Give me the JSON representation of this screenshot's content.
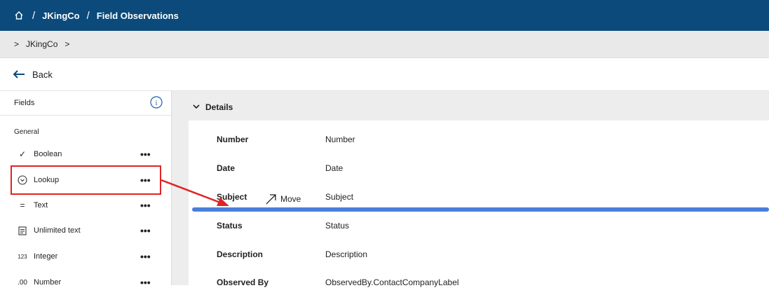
{
  "breadcrumb": {
    "org": "JKingCo",
    "page": "Field Observations"
  },
  "subbar": {
    "org": "JKingCo"
  },
  "back_label": "Back",
  "sidebar": {
    "title": "Fields",
    "group": "General",
    "items": [
      {
        "label": "Boolean",
        "icon": "check-icon",
        "glyph": "✓",
        "more": "•••"
      },
      {
        "label": "Lookup",
        "icon": "lookup-icon",
        "glyph": "⌄",
        "more": "•••"
      },
      {
        "label": "Text",
        "icon": "text-icon",
        "glyph": "=",
        "more": "•••"
      },
      {
        "label": "Unlimited text",
        "icon": "document-icon",
        "glyph": "≡",
        "more": "•••"
      },
      {
        "label": "Integer",
        "icon": "integer-icon",
        "glyph": "123",
        "more": "•••"
      },
      {
        "label": "Number",
        "icon": "decimal-icon",
        "glyph": ".00",
        "more": "•••"
      }
    ]
  },
  "details": {
    "title": "Details",
    "rows": [
      {
        "label": "Number",
        "value": "Number"
      },
      {
        "label": "Date",
        "value": "Date"
      },
      {
        "label": "Subject",
        "value": "Subject"
      },
      {
        "label": "Status",
        "value": "Status"
      },
      {
        "label": "Description",
        "value": "Description"
      },
      {
        "label": "Observed By",
        "value": "ObservedBy.ContactCompanyLabel"
      }
    ]
  },
  "drag": {
    "label": "Move"
  },
  "colors": {
    "topbar": "#0b4a7a",
    "highlight": "#e02424",
    "drop_indicator": "#4a7fd8"
  }
}
